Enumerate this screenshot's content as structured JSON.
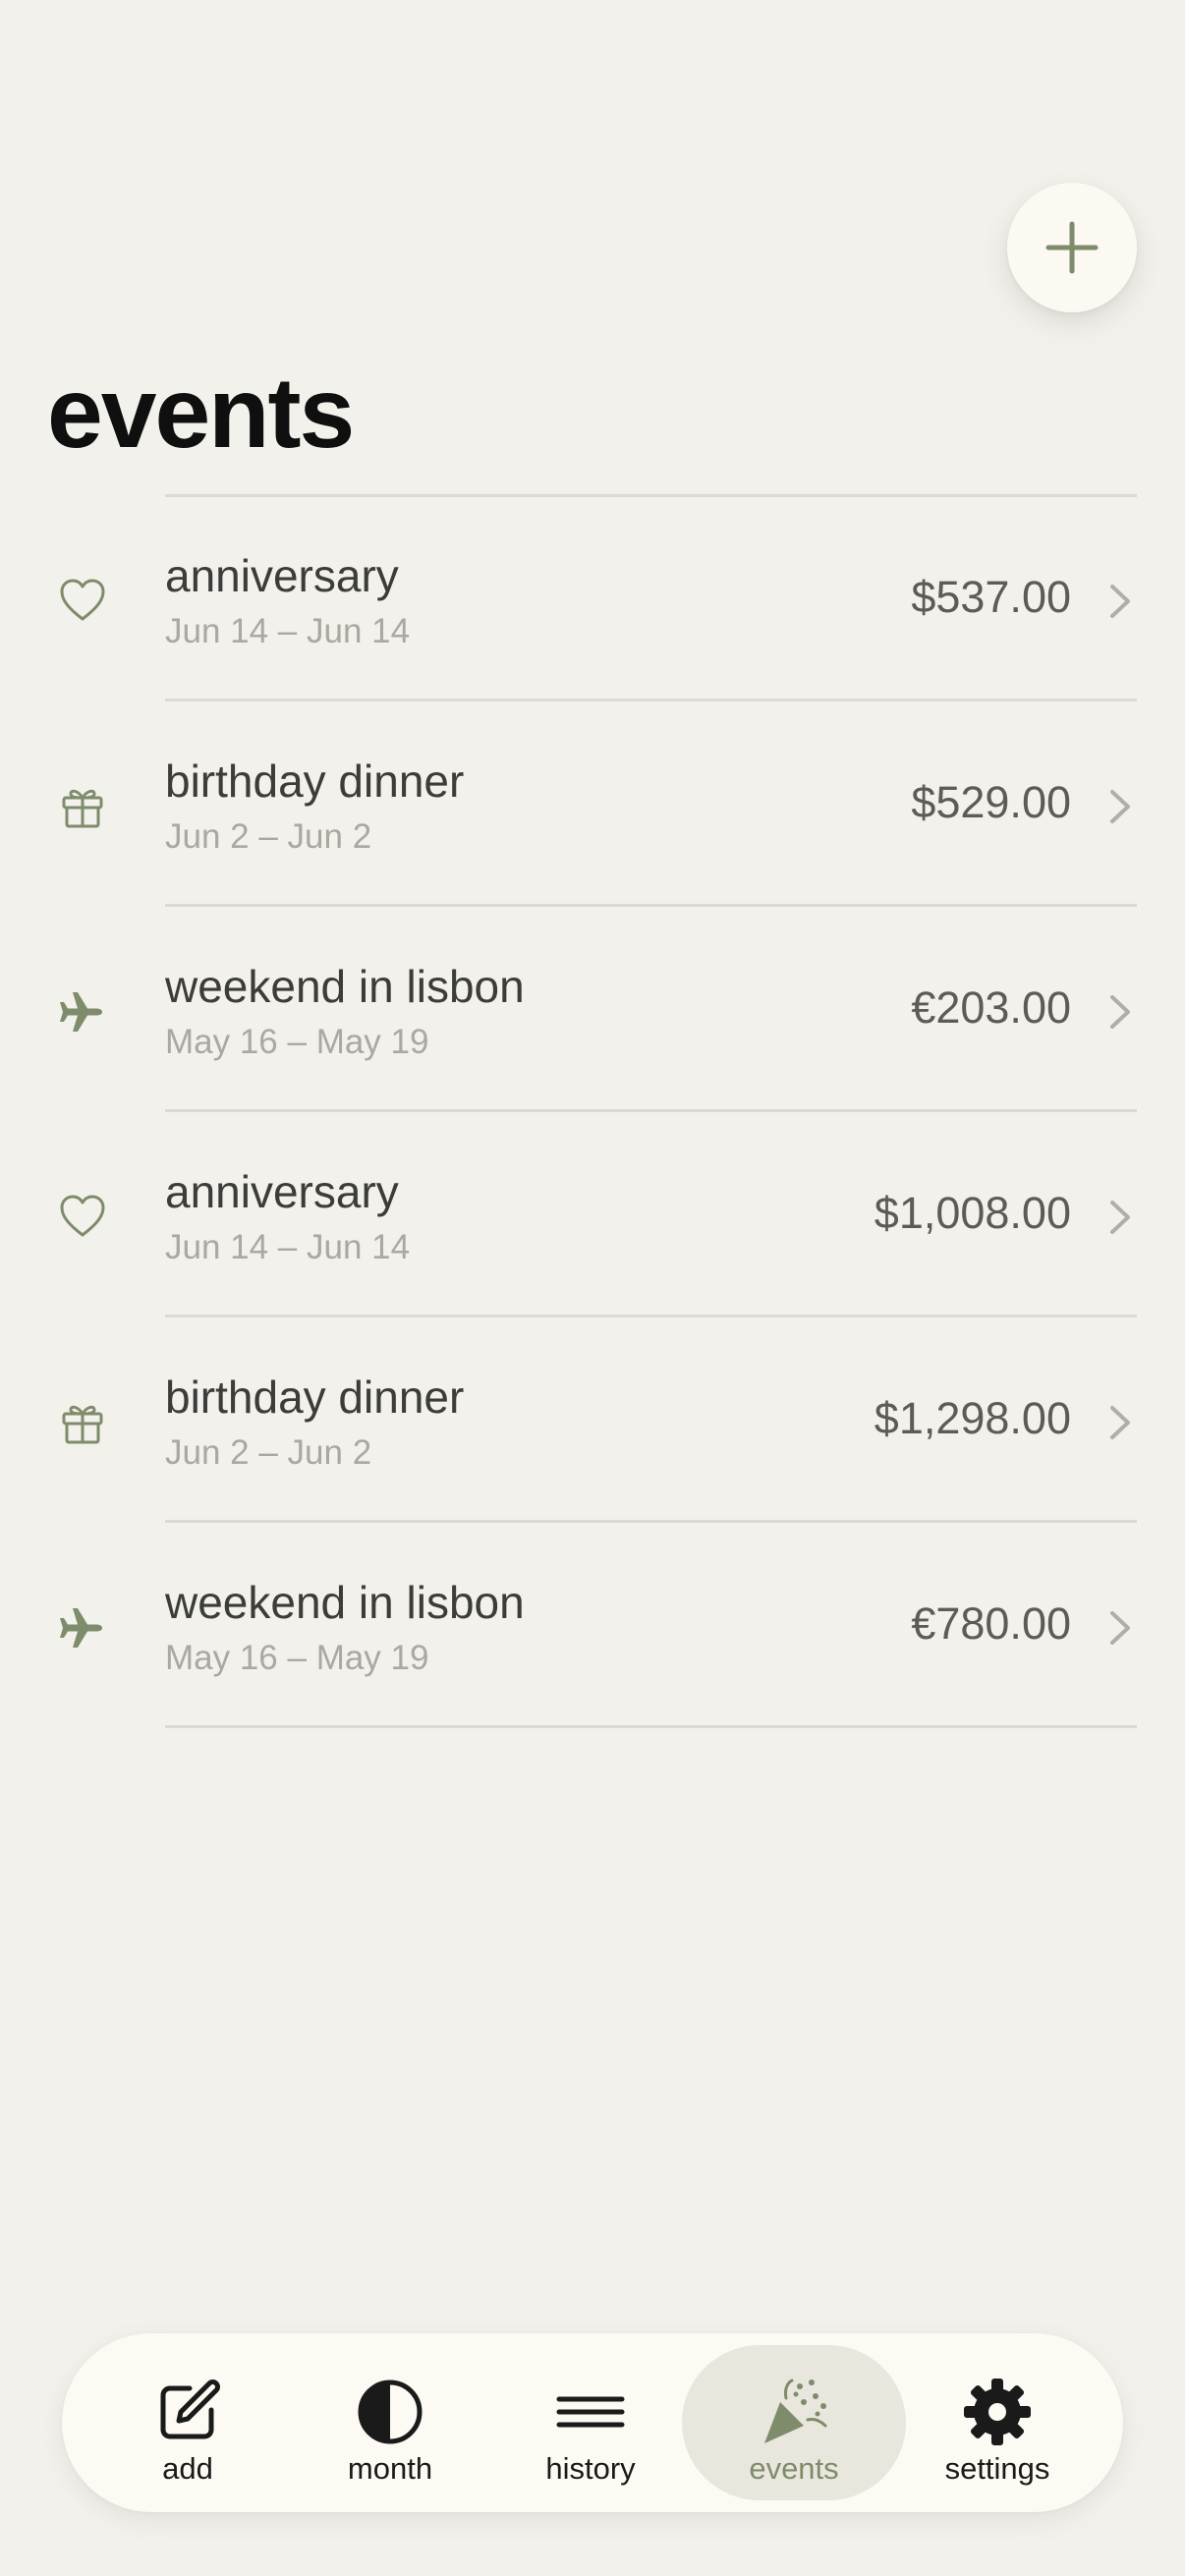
{
  "header": {
    "title": "events",
    "add_button_icon": "plus-icon"
  },
  "colors": {
    "background": "#F3F1EB",
    "accent": "#7E8C6C",
    "text_primary": "#3C3C3A",
    "text_secondary": "#AAA8A1",
    "active_tab_bg": "#E8E6DD"
  },
  "events": [
    {
      "icon": "heart-icon",
      "name": "anniversary",
      "dates": "Jun 14 – Jun 14",
      "amount": "$537.00"
    },
    {
      "icon": "gift-icon",
      "name": "birthday dinner",
      "dates": "Jun 2 – Jun 2",
      "amount": "$529.00"
    },
    {
      "icon": "airplane-icon",
      "name": "weekend in lisbon",
      "dates": "May 16 – May 19",
      "amount": "€203.00"
    },
    {
      "icon": "heart-icon",
      "name": "anniversary",
      "dates": "Jun 14 – Jun 14",
      "amount": "$1,008.00"
    },
    {
      "icon": "gift-icon",
      "name": "birthday dinner",
      "dates": "Jun 2 – Jun 2",
      "amount": "$1,298.00"
    },
    {
      "icon": "airplane-icon",
      "name": "weekend in lisbon",
      "dates": "May 16 – May 19",
      "amount": "€780.00"
    }
  ],
  "tab_bar": {
    "tabs": [
      {
        "label": "add",
        "icon": "compose-icon",
        "active": false
      },
      {
        "label": "month",
        "icon": "half-circle-icon",
        "active": false
      },
      {
        "label": "history",
        "icon": "lines-icon",
        "active": false
      },
      {
        "label": "events",
        "icon": "party-popper-icon",
        "active": true
      },
      {
        "label": "settings",
        "icon": "gear-icon",
        "active": false
      }
    ]
  }
}
